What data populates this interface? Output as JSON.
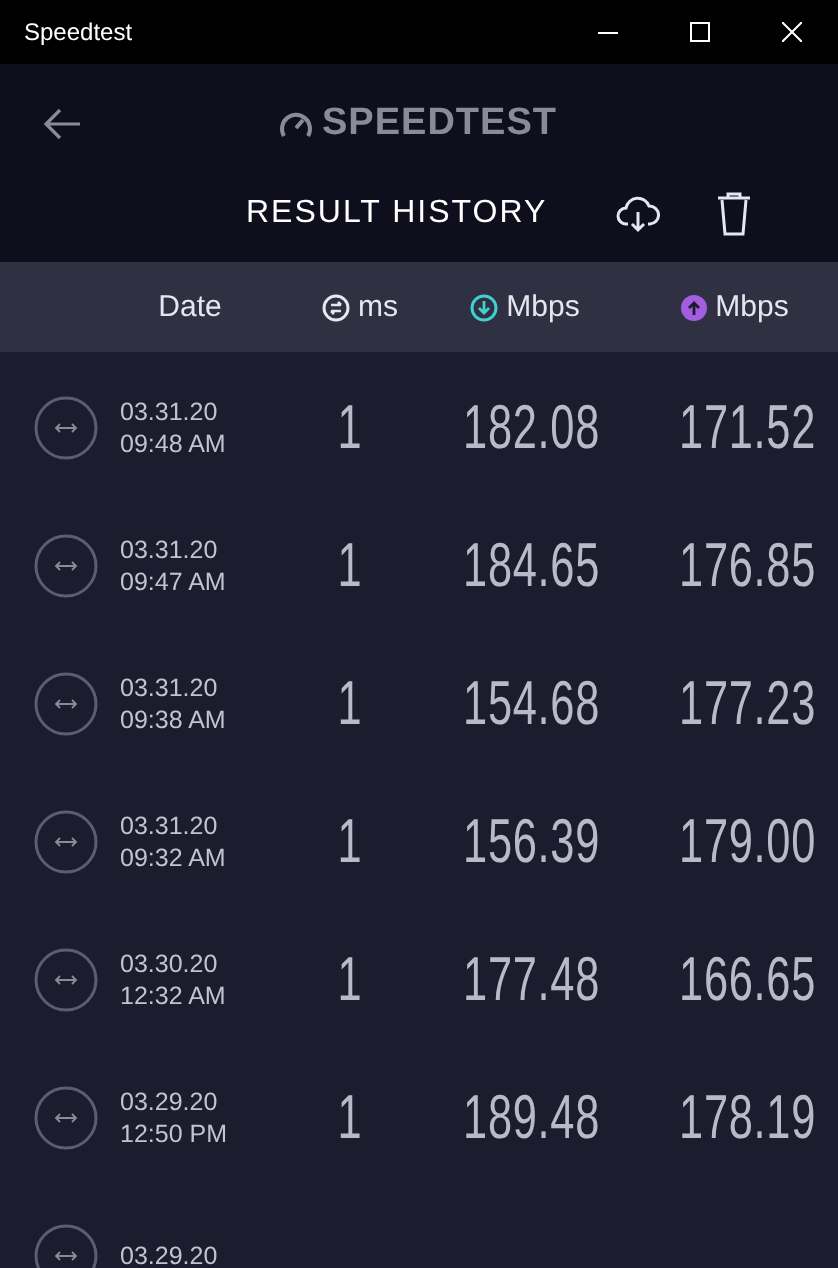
{
  "window": {
    "title": "Speedtest"
  },
  "header": {
    "logo": "SPEEDTEST",
    "title": "RESULT HISTORY"
  },
  "columns": [
    {
      "kind": "date",
      "label": "Date"
    },
    {
      "kind": "ping",
      "label": "ms"
    },
    {
      "kind": "download",
      "label": "Mbps"
    },
    {
      "kind": "upload",
      "label": "Mbps"
    }
  ],
  "rows": [
    {
      "date": "03.31.20",
      "time": "09:48 AM",
      "ping": "1",
      "download": "182.08",
      "upload": "171.52"
    },
    {
      "date": "03.31.20",
      "time": "09:47 AM",
      "ping": "1",
      "download": "184.65",
      "upload": "176.85"
    },
    {
      "date": "03.31.20",
      "time": "09:38 AM",
      "ping": "1",
      "download": "154.68",
      "upload": "177.23"
    },
    {
      "date": "03.31.20",
      "time": "09:32 AM",
      "ping": "1",
      "download": "156.39",
      "upload": "179.00"
    },
    {
      "date": "03.30.20",
      "time": "12:32 AM",
      "ping": "1",
      "download": "177.48",
      "upload": "166.65"
    },
    {
      "date": "03.29.20",
      "time": "12:50 PM",
      "ping": "1",
      "download": "189.48",
      "upload": "178.19"
    },
    {
      "date": "03.29.20"
    }
  ]
}
